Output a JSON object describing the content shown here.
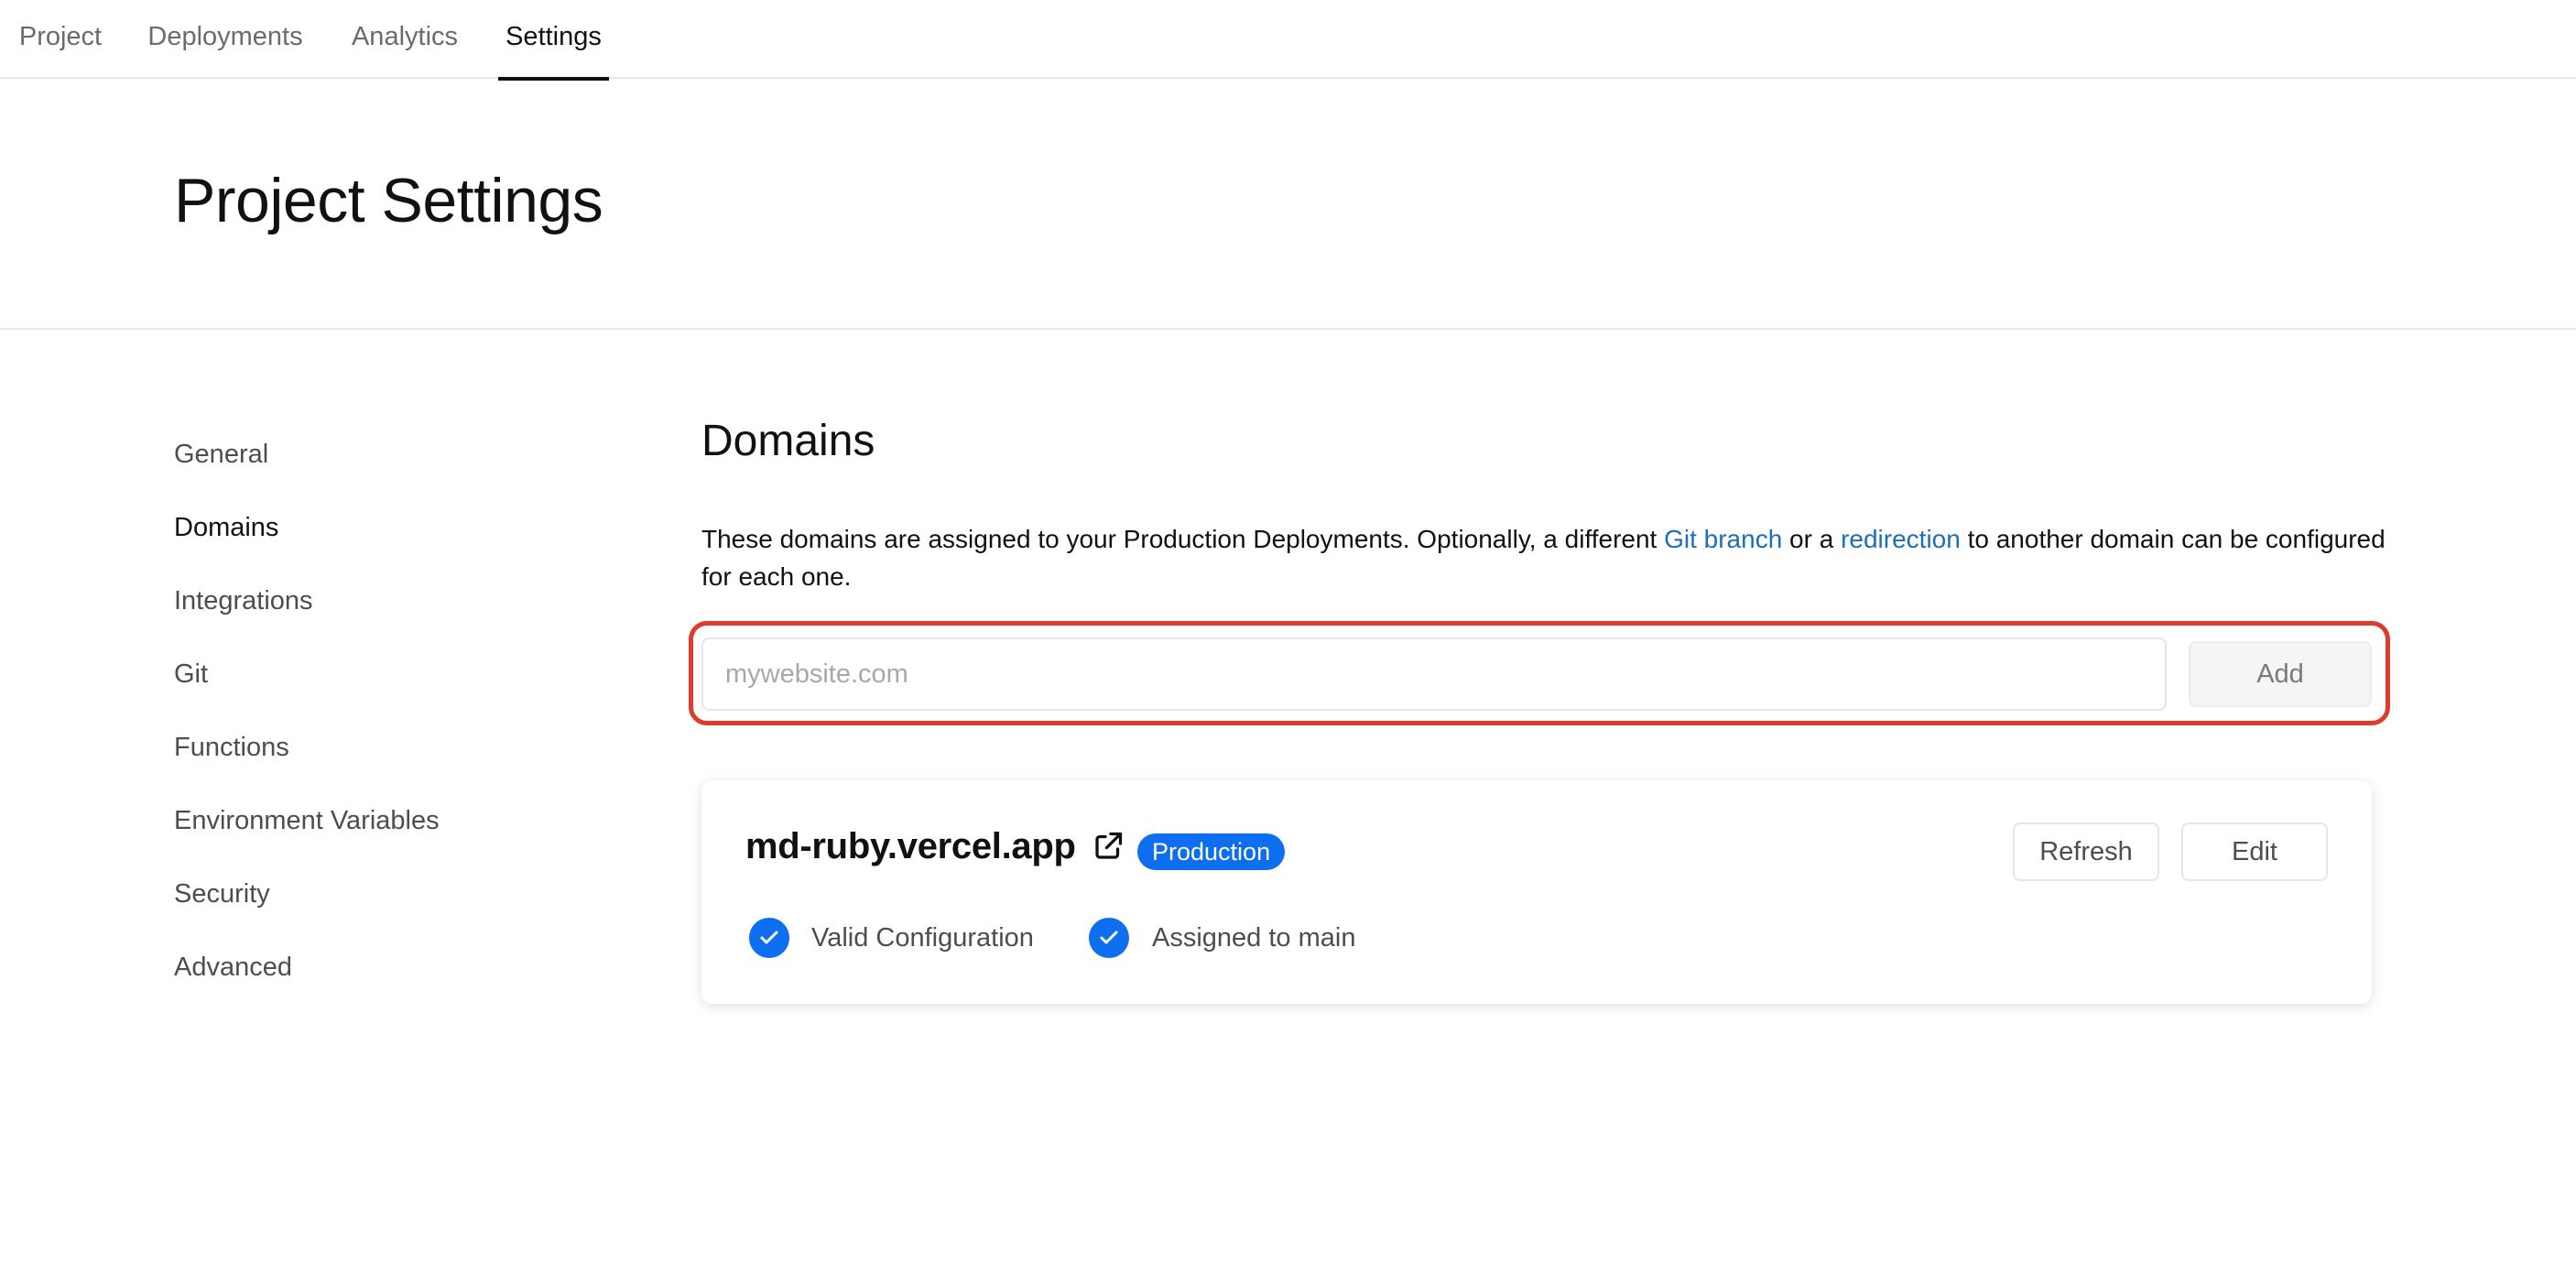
{
  "topnav": {
    "tabs": [
      {
        "label": "Project"
      },
      {
        "label": "Deployments"
      },
      {
        "label": "Analytics"
      },
      {
        "label": "Settings",
        "active": true
      }
    ]
  },
  "header": {
    "title": "Project Settings"
  },
  "sidebar": {
    "items": [
      {
        "label": "General"
      },
      {
        "label": "Domains",
        "active": true
      },
      {
        "label": "Integrations"
      },
      {
        "label": "Git"
      },
      {
        "label": "Functions"
      },
      {
        "label": "Environment Variables"
      },
      {
        "label": "Security"
      },
      {
        "label": "Advanced"
      }
    ]
  },
  "domains": {
    "title": "Domains",
    "description": {
      "part1": "These domains are assigned to your Production Deployments. Optionally, a different ",
      "link1": "Git branch",
      "part2": " or a ",
      "link2": "redirection",
      "part3": " to another domain can be configured for each one."
    },
    "input": {
      "value": "",
      "placeholder": "mywebsite.com"
    },
    "add_label": "Add",
    "card": {
      "domain": "md-ruby.vercel.app",
      "badge": "Production",
      "refresh_label": "Refresh",
      "edit_label": "Edit",
      "status": [
        {
          "label": "Valid Configuration",
          "icon": "check-circle-icon"
        },
        {
          "label": "Assigned to main",
          "icon": "check-circle-icon"
        }
      ]
    }
  },
  "colors": {
    "accent": "#0d6ef0",
    "link": "#1b6fb8",
    "highlight": "#e03a2a"
  }
}
